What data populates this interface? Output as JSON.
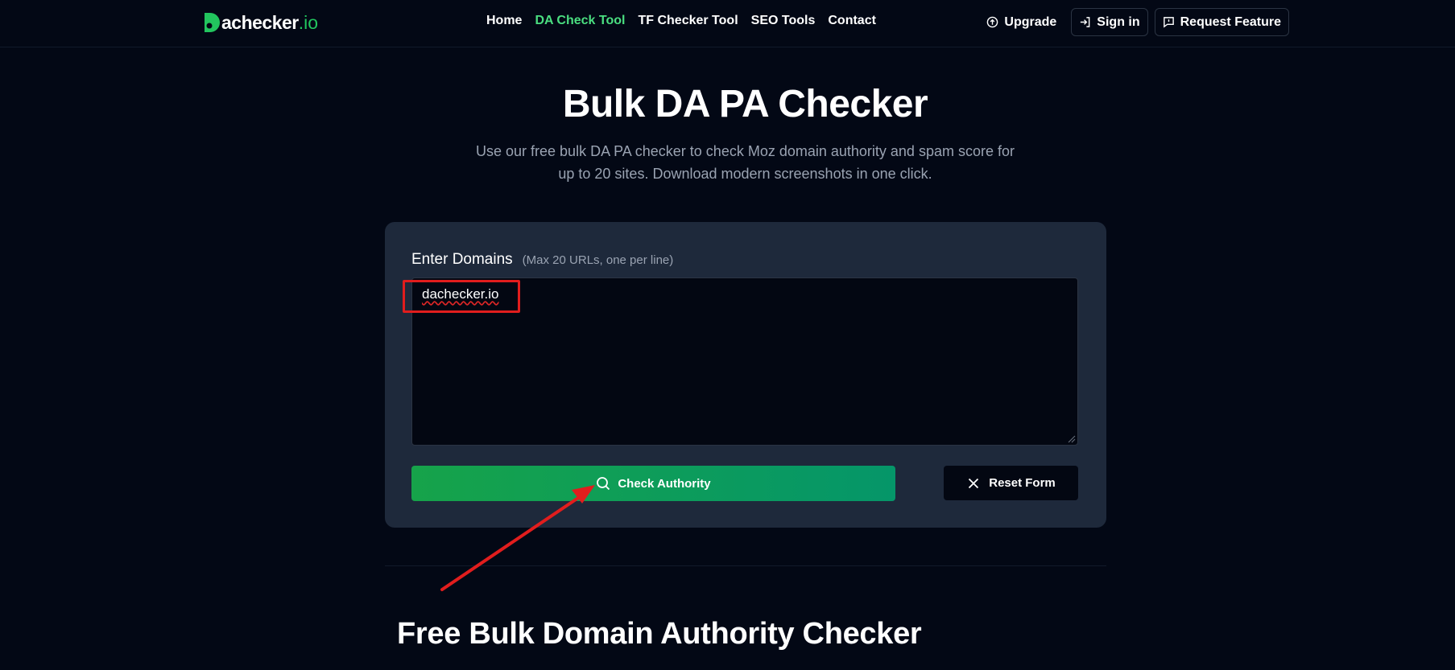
{
  "header": {
    "logo": {
      "text": "achecker",
      "tld": ".io",
      "mark_letter": "D"
    },
    "nav": [
      {
        "label": "Home",
        "active": false
      },
      {
        "label": "DA Check Tool",
        "active": true
      },
      {
        "label": "TF Checker Tool",
        "active": false
      },
      {
        "label": "SEO Tools",
        "active": false
      },
      {
        "label": "Contact",
        "active": false
      }
    ],
    "upgrade_label": "Upgrade",
    "signin_label": "Sign in",
    "request_label": "Request Feature"
  },
  "hero": {
    "title": "Bulk DA PA Checker",
    "subtitle": "Use our free bulk DA PA checker to check Moz domain authority and spam score for up to 20 sites. Download modern screenshots in one click."
  },
  "form": {
    "label": "Enter Domains",
    "hint": "(Max 20 URLs, one per line)",
    "value": "dachecker.io",
    "check_label": "Check Authority",
    "reset_label": "Reset Form"
  },
  "section": {
    "heading": "Free Bulk Domain Authority Checker"
  },
  "colors": {
    "background": "#030815",
    "accent": "#22c55e",
    "nav_active": "#4ade80",
    "card": "#1e293b",
    "annotation": "#e11d1d"
  }
}
